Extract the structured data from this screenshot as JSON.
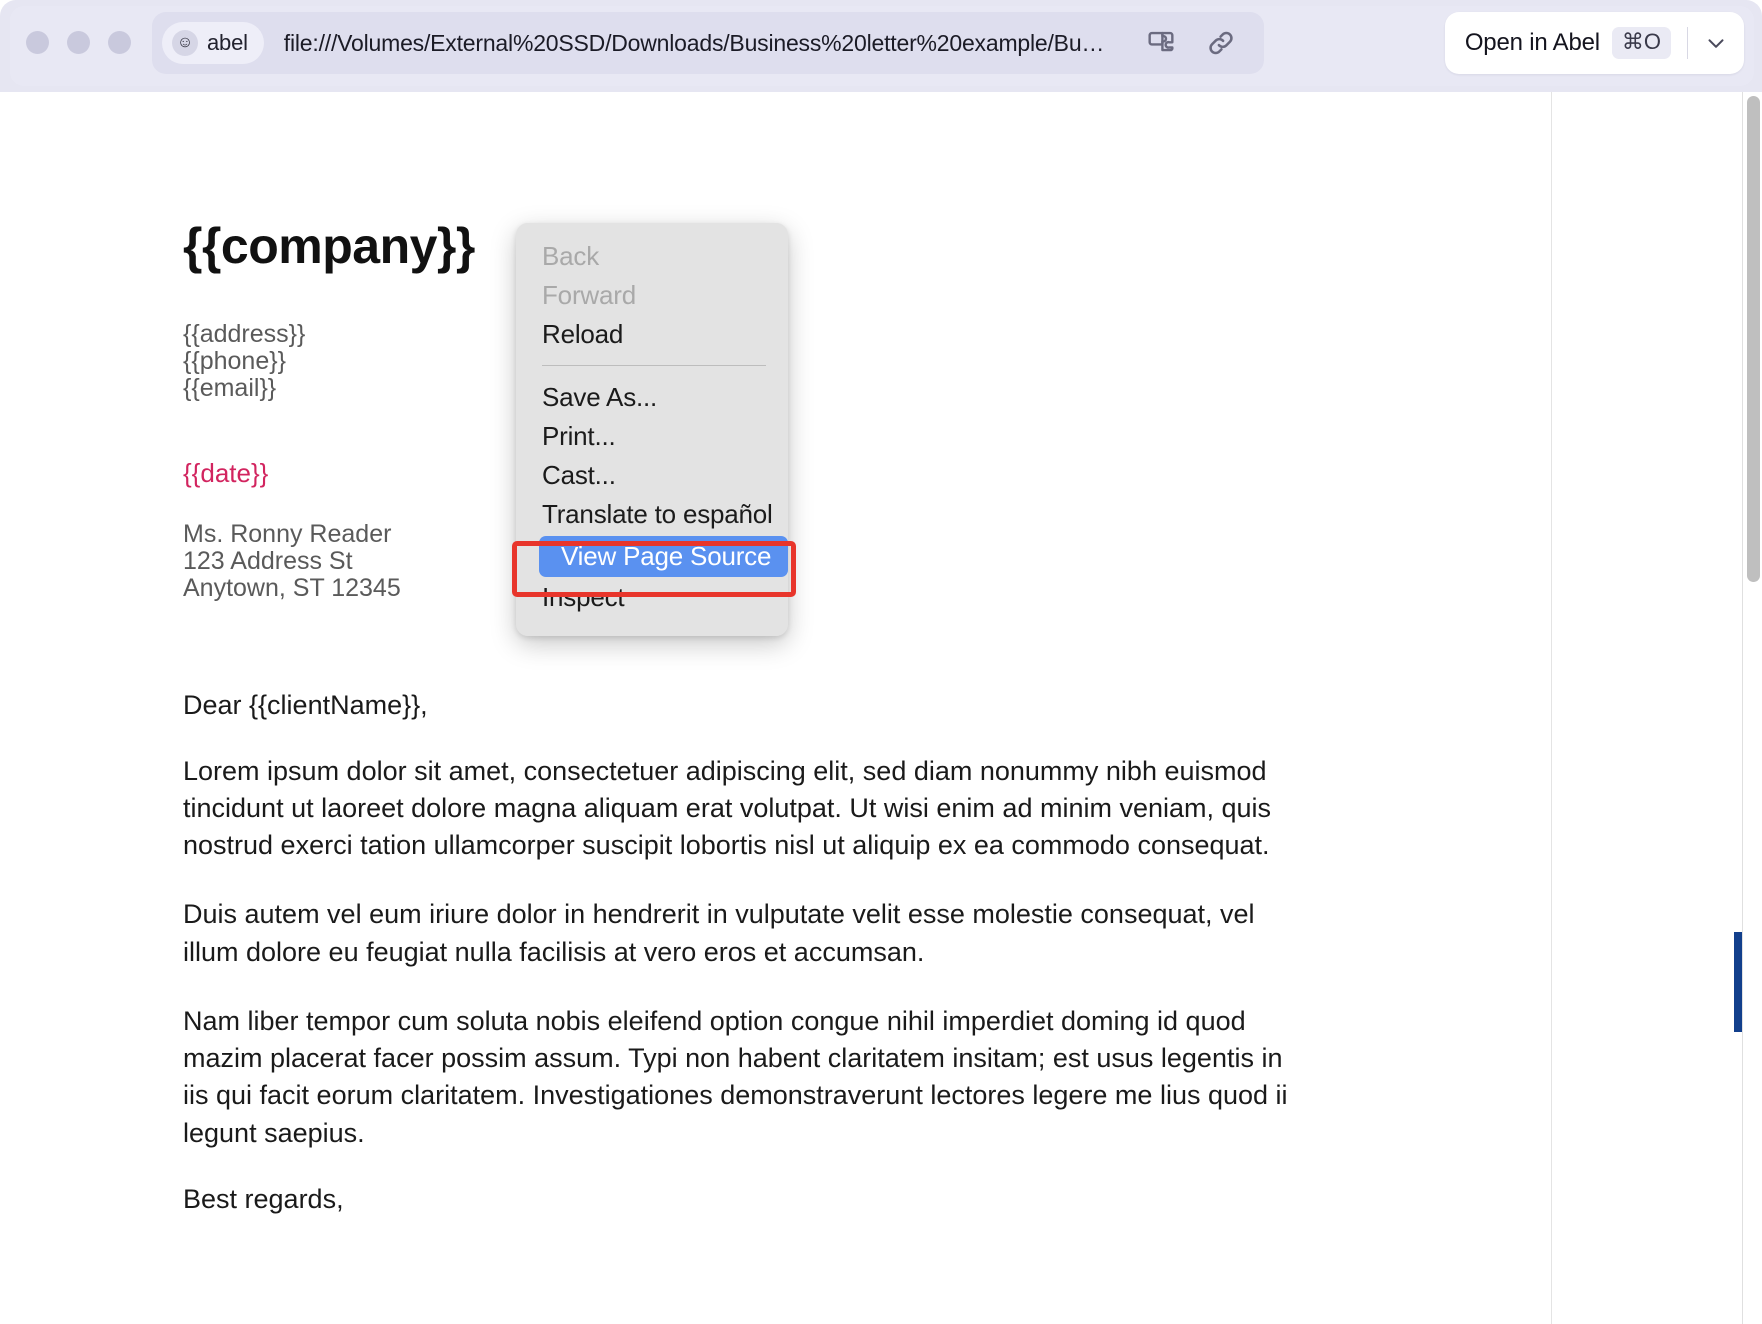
{
  "window": {
    "traffic_lights": [
      "close",
      "minimize",
      "zoom"
    ]
  },
  "urlbar": {
    "profile_name": "abel",
    "profile_icon": "smiley-face-avatar-icon",
    "url": "file:///Volumes/External%20SSD/Downloads/Business%20letter%20example/Bu…",
    "extension_icon": "puzzle-piece-icon",
    "link_icon": "link-chain-icon"
  },
  "open_in_abel": {
    "label": "Open in Abel",
    "shortcut": "⌘O",
    "chevron_icon": "chevron-down-icon"
  },
  "letter": {
    "company": "{{company}}",
    "contact": [
      "{{address}}",
      "{{phone}}",
      "{{email}}"
    ],
    "date": "{{date}}",
    "date_color": "#d2245f",
    "recipient": [
      "Ms. Ronny Reader",
      "123 Address St",
      "Anytown, ST 12345"
    ],
    "salutation": "Dear {{clientName}},",
    "paragraphs": [
      "Lorem ipsum dolor sit amet, consectetuer adipiscing elit, sed diam nonummy nibh euismod tincidunt ut laoreet dolore magna aliquam erat volutpat. Ut wisi enim ad minim veniam, quis nostrud exerci tation ullamcorper suscipit lobortis nisl ut aliquip ex ea commodo consequat.",
      "Duis autem vel eum iriure dolor in hendrerit in vulputate velit esse molestie consequat, vel illum dolore eu feugiat nulla facilisis at vero eros et accumsan.",
      "Nam liber tempor cum soluta nobis eleifend option congue nihil imperdiet doming id quod mazim placerat facer possim assum. Typi non habent claritatem insitam; est usus legentis in iis qui facit eorum claritatem. Investigationes demonstraverunt lectores legere me lius quod ii legunt saepius."
    ],
    "signoff": "Best regards,"
  },
  "context_menu": {
    "items": [
      {
        "label": "Back",
        "state": "disabled"
      },
      {
        "label": "Forward",
        "state": "disabled"
      },
      {
        "label": "Reload",
        "state": "enabled"
      },
      {
        "label": "Save As...",
        "state": "enabled"
      },
      {
        "label": "Print...",
        "state": "enabled"
      },
      {
        "label": "Cast...",
        "state": "enabled"
      },
      {
        "label": "Translate to español",
        "state": "enabled"
      },
      {
        "label": "View Page Source",
        "state": "selected"
      },
      {
        "label": "Inspect",
        "state": "enabled"
      }
    ],
    "selected_label": "View Page Source",
    "highlight_color": "#5a91f0",
    "annotation_color": "#e8352b"
  },
  "scrollbar": {
    "orientation": "vertical",
    "thumb_position_pct": 0
  }
}
